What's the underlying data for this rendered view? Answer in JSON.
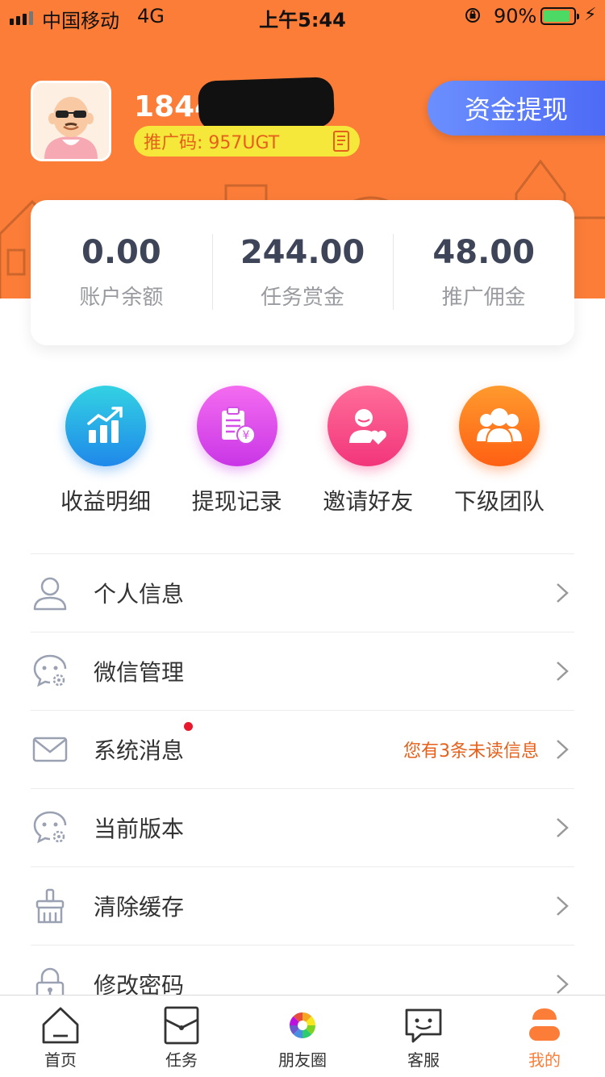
{
  "status_bar": {
    "carrier": "中国移动",
    "network": "4G",
    "time": "上午5:44",
    "battery": "90%",
    "battery_level": 0.9
  },
  "profile": {
    "phone": "1844",
    "promo_code": "推广码: 957UGT",
    "withdraw_label": "资金提现"
  },
  "stats": [
    {
      "value": "0.00",
      "label": "账户余额"
    },
    {
      "value": "244.00",
      "label": "任务赏金"
    },
    {
      "value": "48.00",
      "label": "推广佣金"
    }
  ],
  "actions": [
    {
      "label": "收益明细",
      "icon": "chart-up-icon"
    },
    {
      "label": "提现记录",
      "icon": "withdraw-record-icon"
    },
    {
      "label": "邀请好友",
      "icon": "invite-friend-icon"
    },
    {
      "label": "下级团队",
      "icon": "team-icon"
    }
  ],
  "menu": [
    {
      "label": "个人信息",
      "icon": "user-icon"
    },
    {
      "label": "微信管理",
      "icon": "wechat-settings-icon"
    },
    {
      "label": "系统消息",
      "icon": "mail-icon",
      "hint": "您有3条未读信息",
      "has_dot": true
    },
    {
      "label": "当前版本",
      "icon": "version-icon"
    },
    {
      "label": "清除缓存",
      "icon": "broom-icon"
    },
    {
      "label": "修改密码",
      "icon": "lock-icon"
    }
  ],
  "tabs": [
    {
      "label": "首页",
      "icon": "home-icon"
    },
    {
      "label": "任务",
      "icon": "task-icon"
    },
    {
      "label": "朋友圈",
      "icon": "moments-icon"
    },
    {
      "label": "客服",
      "icon": "service-icon"
    },
    {
      "label": "我的",
      "icon": "profile-icon",
      "active": true
    }
  ],
  "colors": {
    "brand": "#fb7d38",
    "withdraw_button": "#5a7bfa",
    "promo_badge": "#f5e83a",
    "notice_dot": "#e8192c"
  }
}
